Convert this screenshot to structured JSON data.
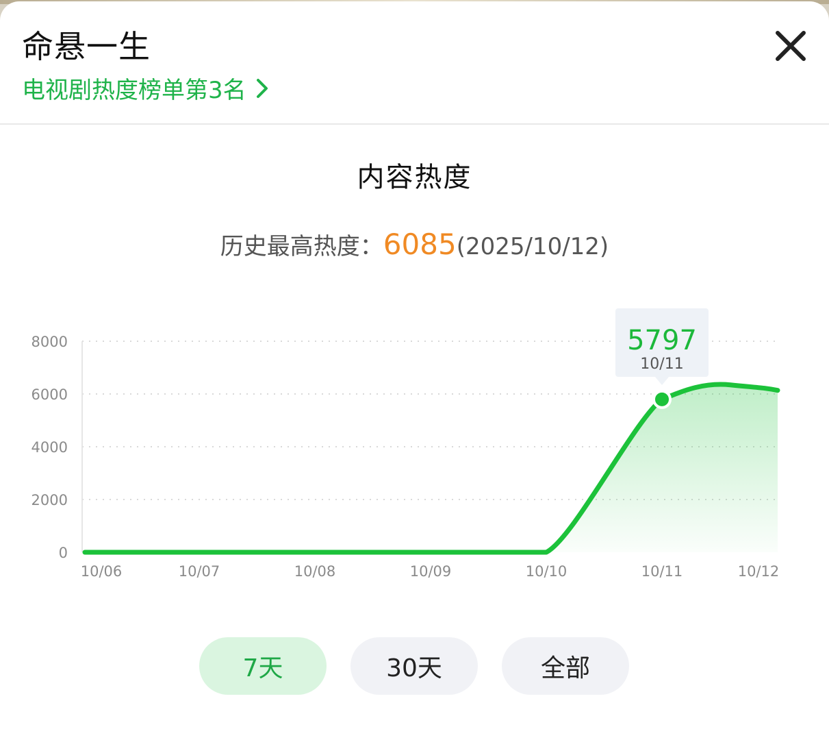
{
  "header": {
    "title": "命悬一生",
    "rank_link": "电视剧热度榜单第3名"
  },
  "section": {
    "title": "内容热度"
  },
  "peak": {
    "label": "历史最高热度：",
    "value": "6085",
    "date": "(2025/10/12)"
  },
  "colors": {
    "accent_green": "#1fb34a",
    "line_green": "#1cc23a",
    "peak_orange": "#f08a24"
  },
  "tooltip": {
    "value": "5797",
    "date": "10/11"
  },
  "chart_data": {
    "type": "area",
    "x": [
      "10/06",
      "10/07",
      "10/08",
      "10/09",
      "10/10",
      "10/11",
      "10/12"
    ],
    "series": [
      {
        "values": [
          0,
          0,
          0,
          0,
          0,
          5797,
          6085
        ]
      }
    ],
    "y_ticks": [
      "0",
      "2000",
      "4000",
      "6000",
      "8000"
    ],
    "ylim": [
      0,
      8000
    ],
    "grid": true,
    "highlighted_point": {
      "x": "10/11",
      "y": 5797
    }
  },
  "tabs": [
    {
      "label": "7天",
      "active": true
    },
    {
      "label": "30天",
      "active": false
    },
    {
      "label": "全部",
      "active": false
    }
  ]
}
